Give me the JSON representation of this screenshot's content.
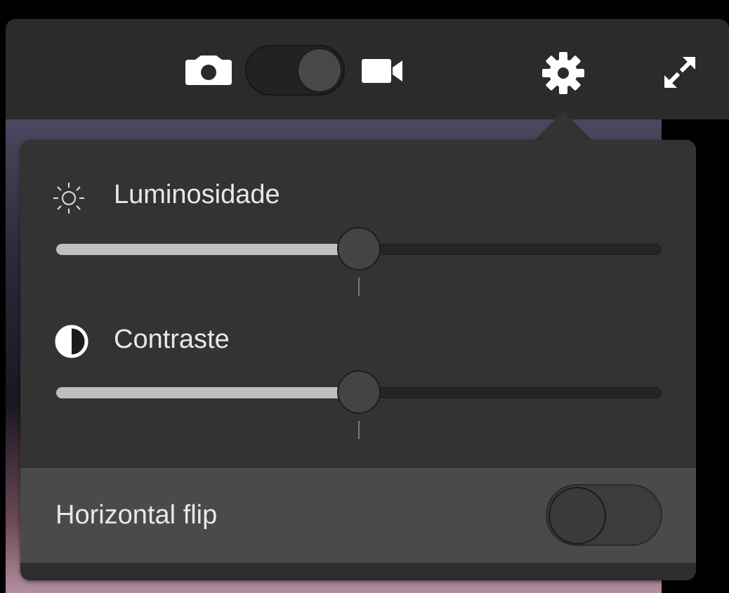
{
  "toolbar": {
    "icons": {
      "photo": "camera-icon",
      "video": "video-camera-icon",
      "settings": "gear-icon",
      "fullscreen": "expand-icon"
    },
    "mode_toggle": {
      "state": "video"
    }
  },
  "settings_panel": {
    "brightness": {
      "label": "Luminosidade",
      "icon": "sun-icon",
      "value_percent": 50
    },
    "contrast": {
      "label": "Contraste",
      "icon": "contrast-icon",
      "value_percent": 50
    },
    "horizontal_flip": {
      "label": "Horizontal flip",
      "enabled": false
    }
  },
  "colors": {
    "toolbar_bg": "#2b2b2b",
    "panel_bg": "#333333",
    "flip_row_bg": "#4a4a4a",
    "slider_fill": "#bfbfbf",
    "text": "#e8e8e8"
  }
}
